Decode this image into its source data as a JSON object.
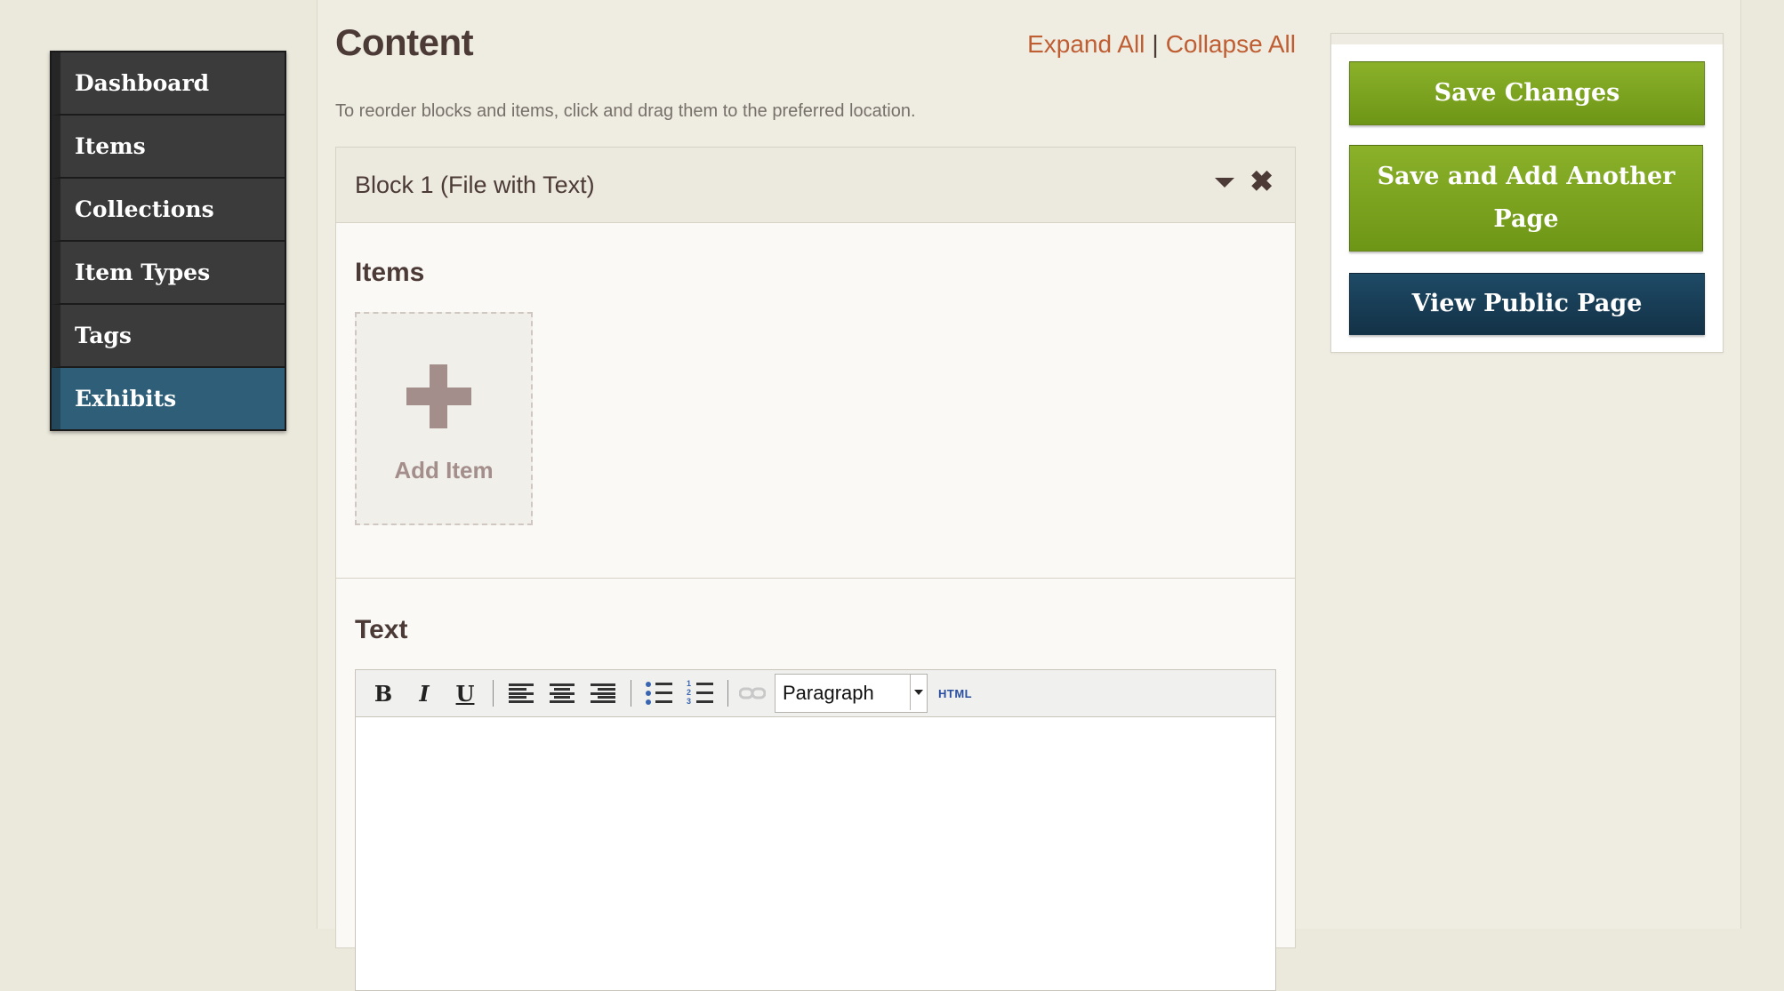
{
  "sidebar": {
    "items": [
      {
        "label": "Dashboard",
        "active": false
      },
      {
        "label": "Items",
        "active": false
      },
      {
        "label": "Collections",
        "active": false
      },
      {
        "label": "Item Types",
        "active": false
      },
      {
        "label": "Tags",
        "active": false
      },
      {
        "label": "Exhibits",
        "active": true
      }
    ]
  },
  "content": {
    "title": "Content",
    "expand_all": "Expand All",
    "separator": "|",
    "collapse_all": "Collapse All",
    "instructions": "To reorder blocks and items, click and drag them to the preferred location."
  },
  "block": {
    "title": "Block 1 (File with Text)",
    "collapse_icon": "triangle-down-icon",
    "remove_icon": "close-icon",
    "remove_glyph": "✖",
    "items_heading": "Items",
    "add_item_label": "Add Item",
    "text_heading": "Text"
  },
  "editor": {
    "toolbar": {
      "bold": "B",
      "italic": "I",
      "underline": "U",
      "format_value": "Paragraph",
      "html_label": "HTML"
    }
  },
  "actions": {
    "save_changes": "Save Changes",
    "save_and_add": "Save and Add Another Page",
    "view_public": "View Public Page"
  },
  "colors": {
    "accent_link": "#bf5e33",
    "green_button": "#7ba41f",
    "blue_button": "#1a3f58",
    "active_nav": "#2e5e78"
  }
}
